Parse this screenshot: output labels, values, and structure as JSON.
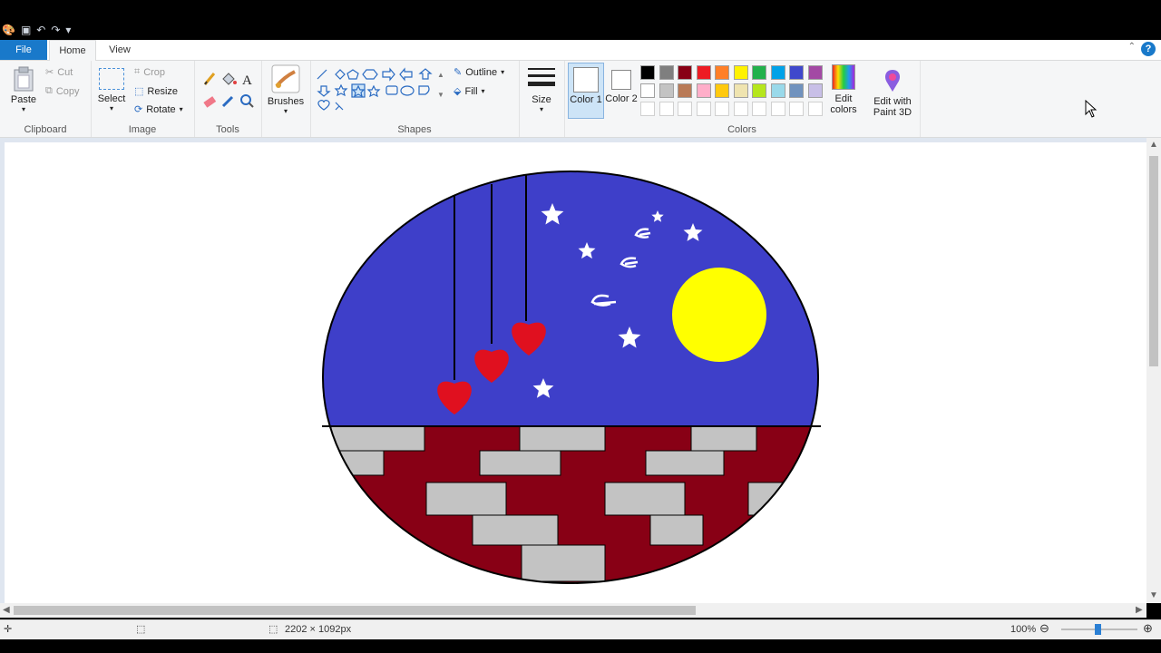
{
  "tabs": {
    "file": "File",
    "home": "Home",
    "view": "View"
  },
  "help_glyph": "?",
  "clipboard": {
    "paste": "Paste",
    "cut": "Cut",
    "copy": "Copy",
    "label": "Clipboard"
  },
  "image": {
    "select": "Select",
    "crop": "Crop",
    "resize": "Resize",
    "rotate": "Rotate",
    "label": "Image"
  },
  "tools": {
    "label": "Tools"
  },
  "brushes": {
    "label": "Brushes"
  },
  "shapes": {
    "outline": "Outline",
    "fill": "Fill",
    "label": "Shapes"
  },
  "size": {
    "label": "Size"
  },
  "colors": {
    "color1": "Color 1",
    "color2": "Color 2",
    "edit_colors": "Edit colors",
    "edit_paint3d": "Edit with Paint 3D",
    "label": "Colors",
    "palette_row1": [
      "#000000",
      "#7f7f7f",
      "#880015",
      "#ed1c24",
      "#ff7f27",
      "#fff200",
      "#22b14c",
      "#00a2e8",
      "#3f48cc",
      "#a349a4"
    ],
    "palette_row2": [
      "#ffffff",
      "#c3c3c3",
      "#b97a57",
      "#ffaec9",
      "#ffc90e",
      "#efe4b0",
      "#b5e61d",
      "#99d9ea",
      "#7092be",
      "#c8bfe7"
    ]
  },
  "status": {
    "dimensions": "2202 × 1092px",
    "zoom": "100%"
  },
  "drawing_colors": {
    "sky": "#3e3fc9",
    "moon": "#ffff00",
    "heart": "#e0101f",
    "brick": "#880015",
    "stone": "#c3c3c3"
  }
}
